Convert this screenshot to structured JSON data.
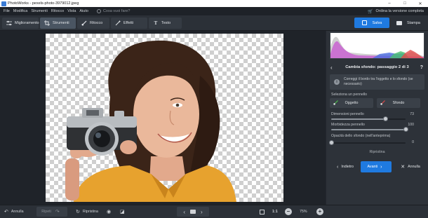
{
  "window": {
    "title": "PhotoWorks - pexels-photo-3979012.jpeg",
    "controls": [
      "–",
      "□",
      "✕"
    ]
  },
  "menu": {
    "items": [
      "File",
      "Modifica",
      "Strumenti",
      "Ritocco",
      "Vista",
      "Aiuto"
    ],
    "search_placeholder": "Cosa vuoi fare?",
    "order_label": "Ordina la versione completa"
  },
  "toolbar": {
    "tabs": [
      {
        "label": "Miglioramento",
        "icon": "sliders-icon"
      },
      {
        "label": "Strumenti",
        "icon": "crop-icon"
      },
      {
        "label": "Ritocco",
        "icon": "brush-icon"
      },
      {
        "label": "Effetti",
        "icon": "magic-wand-icon"
      },
      {
        "label": "Testo",
        "icon": "text-icon"
      }
    ],
    "active_tab": "Strumenti",
    "save_label": "Salva",
    "print_label": "Stampa"
  },
  "panel": {
    "title": "Cambia sfondo: passaggio 2 di 3",
    "info_text": "Correggi il bordo tra l'oggetto e lo sfondo (se necessario)",
    "brush_section": "Seleziona un pennello",
    "brushes": [
      "Oggetto",
      "Sfondo"
    ],
    "sliders": [
      {
        "label": "Dimensioni pennello",
        "value": "73",
        "fraction": 0.73
      },
      {
        "label": "Morbidezza pennello",
        "value": "100",
        "fraction": 1.0
      },
      {
        "label": "Opacità dello sfondo (nell'anteprima)",
        "value": "0",
        "fraction": 0.0
      }
    ],
    "reset_label": "Ripristina",
    "back_label": "Indietro",
    "next_label": "Avanti",
    "cancel_label": "Annulla"
  },
  "bottom": {
    "undo_label": "Annulla",
    "redo_label": "Ripeti",
    "restore_label": "Ripristina",
    "ratio_label": "1:1",
    "zoom_label": "75%"
  },
  "colors": {
    "accent": "#1f7ae0",
    "background": "#23272e",
    "panel": "#2d3239"
  }
}
